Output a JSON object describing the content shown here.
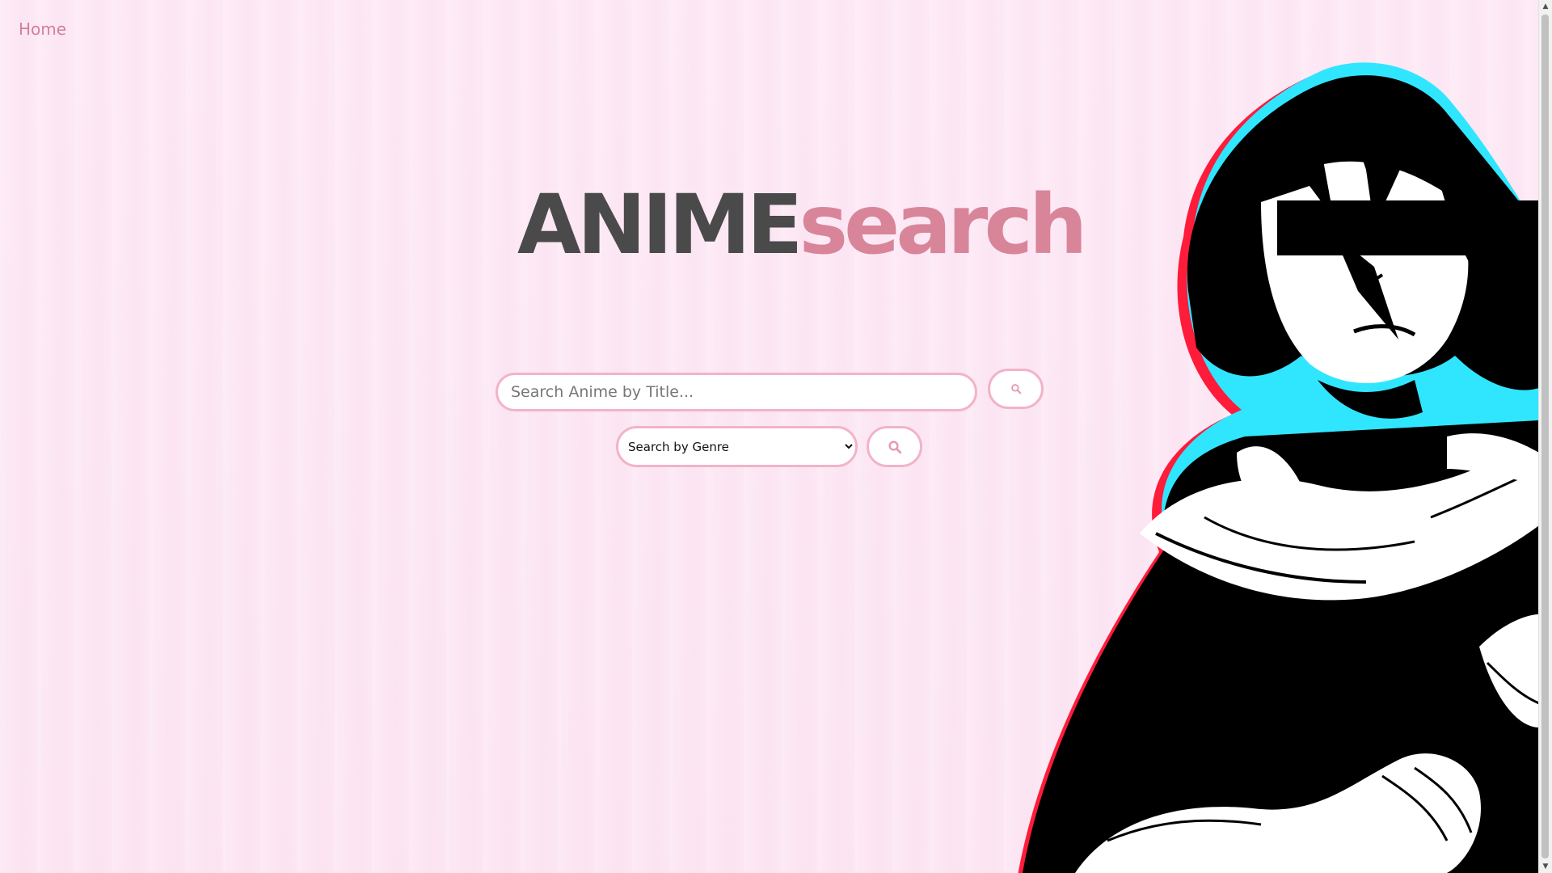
{
  "nav": {
    "home_label": "Home"
  },
  "logo": {
    "part_a": "ANIME",
    "part_b": "search"
  },
  "search": {
    "title_placeholder": "Search Anime by Title...",
    "title_button_icon": "search-icon",
    "genre_selected": "Search by Genre",
    "genre_button_icon": "search-icon"
  },
  "colors": {
    "background": "#fde8f4",
    "accent": "#d8859a",
    "logo_dark": "#4a4a4a",
    "border": "#f2b3c8"
  }
}
